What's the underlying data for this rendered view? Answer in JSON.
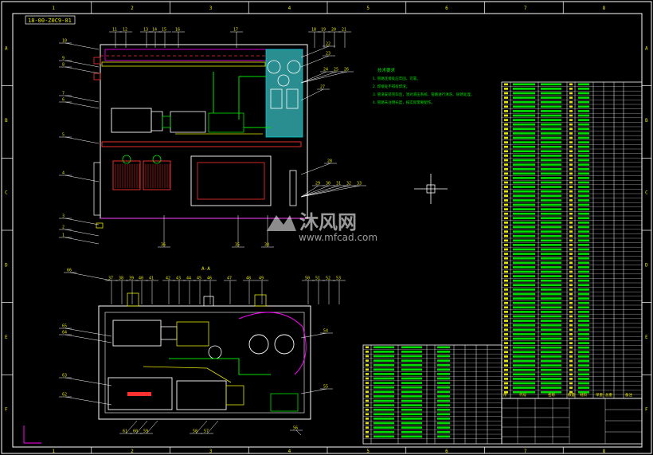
{
  "drawing": {
    "title_code": "18-00-Z0C9-01",
    "section_label": "A-A",
    "tech_requirements": [
      "技术要求",
      "1. 管路连接处应牢固、可靠。",
      "2. 焊接处不得有焊渣。",
      "3. 管道安装完毕后，须对液压系统、管路进行清洗、除锈处理。",
      "4. 管路未注明长度，按实际需要配作。"
    ],
    "frame_numbers_top": [
      "1",
      "2",
      "3",
      "4",
      "5",
      "6",
      "7",
      "8"
    ],
    "frame_letters_side": [
      "A",
      "B",
      "C",
      "D",
      "E",
      "F"
    ],
    "balloons_top": [
      "11",
      "12",
      "13",
      "14",
      "15",
      "16",
      "17",
      "18",
      "19",
      "20",
      "21"
    ],
    "balloons_left_top": [
      "10",
      "9",
      "8",
      "7",
      "6",
      "5",
      "4",
      "3",
      "2",
      "1"
    ],
    "balloons_right_top": [
      "22",
      "23",
      "24",
      "25",
      "26",
      "27",
      "28",
      "29",
      "30",
      "31",
      "32",
      "33"
    ],
    "balloons_bottom_top": [
      "36",
      "35",
      "34"
    ],
    "balloons_section_top": [
      "37",
      "38",
      "39",
      "40",
      "41",
      "42",
      "43",
      "44",
      "45",
      "46",
      "47",
      "48",
      "49",
      "50",
      "51",
      "52",
      "53"
    ],
    "balloons_section_left": [
      "66",
      "65",
      "64",
      "63",
      "62"
    ],
    "balloons_section_right": [
      "54",
      "55",
      "56"
    ],
    "balloons_section_bottom": [
      "61",
      "60",
      "59",
      "58",
      "57"
    ],
    "watermark": {
      "brand": "沐风网",
      "url": "www.mfcad.com"
    },
    "title_block_labels": [
      "序",
      "代号",
      "名称",
      "数量",
      "材料",
      "单重",
      "总重",
      "备注"
    ]
  },
  "colors": {
    "frame": "#ffffff",
    "yellow": "#e8e800",
    "green": "#00e000",
    "cyan": "#00d0d0",
    "red": "#ff3030",
    "magenta": "#ff00ff",
    "teal_panel": "#2a8d8f"
  }
}
